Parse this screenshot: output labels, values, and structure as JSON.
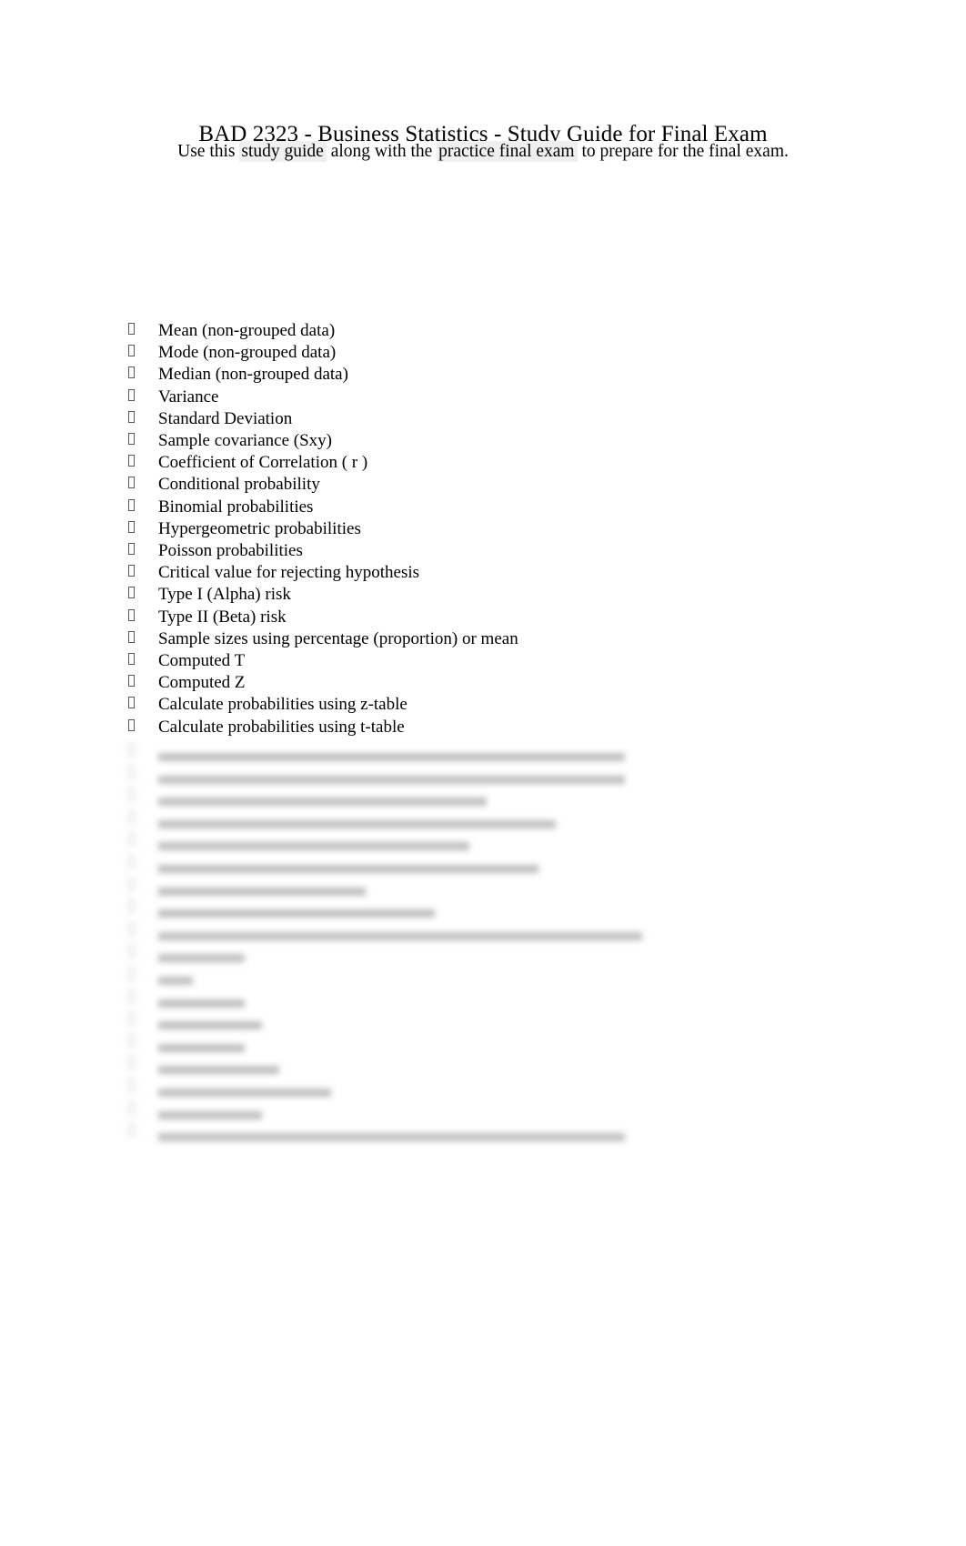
{
  "document": {
    "title": "BAD 2323 - Business Statistics - Study Guide for Final Exam",
    "subtitle": {
      "part_1": "Use this ",
      "link_1": "study guide",
      "part_2": " along with the ",
      "link_2": "practice final exam",
      "part_3": " to prepare for the final exam."
    },
    "bullet_glyph": "missing-glyph-box",
    "checklist": [
      "Mean (non-grouped data)",
      "Mode (non-grouped data)",
      "Median (non-grouped data)",
      "Variance",
      "Standard Deviation",
      "Sample covariance (Sxy)",
      "Coefficient of Correlation ( r )",
      "Conditional probability",
      "Binomial probabilities",
      "Hypergeometric probabilities",
      "Poisson probabilities",
      "Critical value for rejecting hypothesis",
      "Type I (Alpha) risk",
      "Type II (Beta) risk",
      "Sample sizes using percentage (proportion) or mean",
      "Computed T",
      "Computed Z",
      "Calculate probabilities using z-table",
      "Calculate probabilities using t-table"
    ],
    "redacted_lines": [
      "                           ",
      "                           ",
      "                   ",
      "                       ",
      "                  ",
      "                      ",
      "            ",
      "                ",
      "                            ",
      "     ",
      "  ",
      "     ",
      "      ",
      "     ",
      "       ",
      "          ",
      "      ",
      "                           "
    ]
  }
}
